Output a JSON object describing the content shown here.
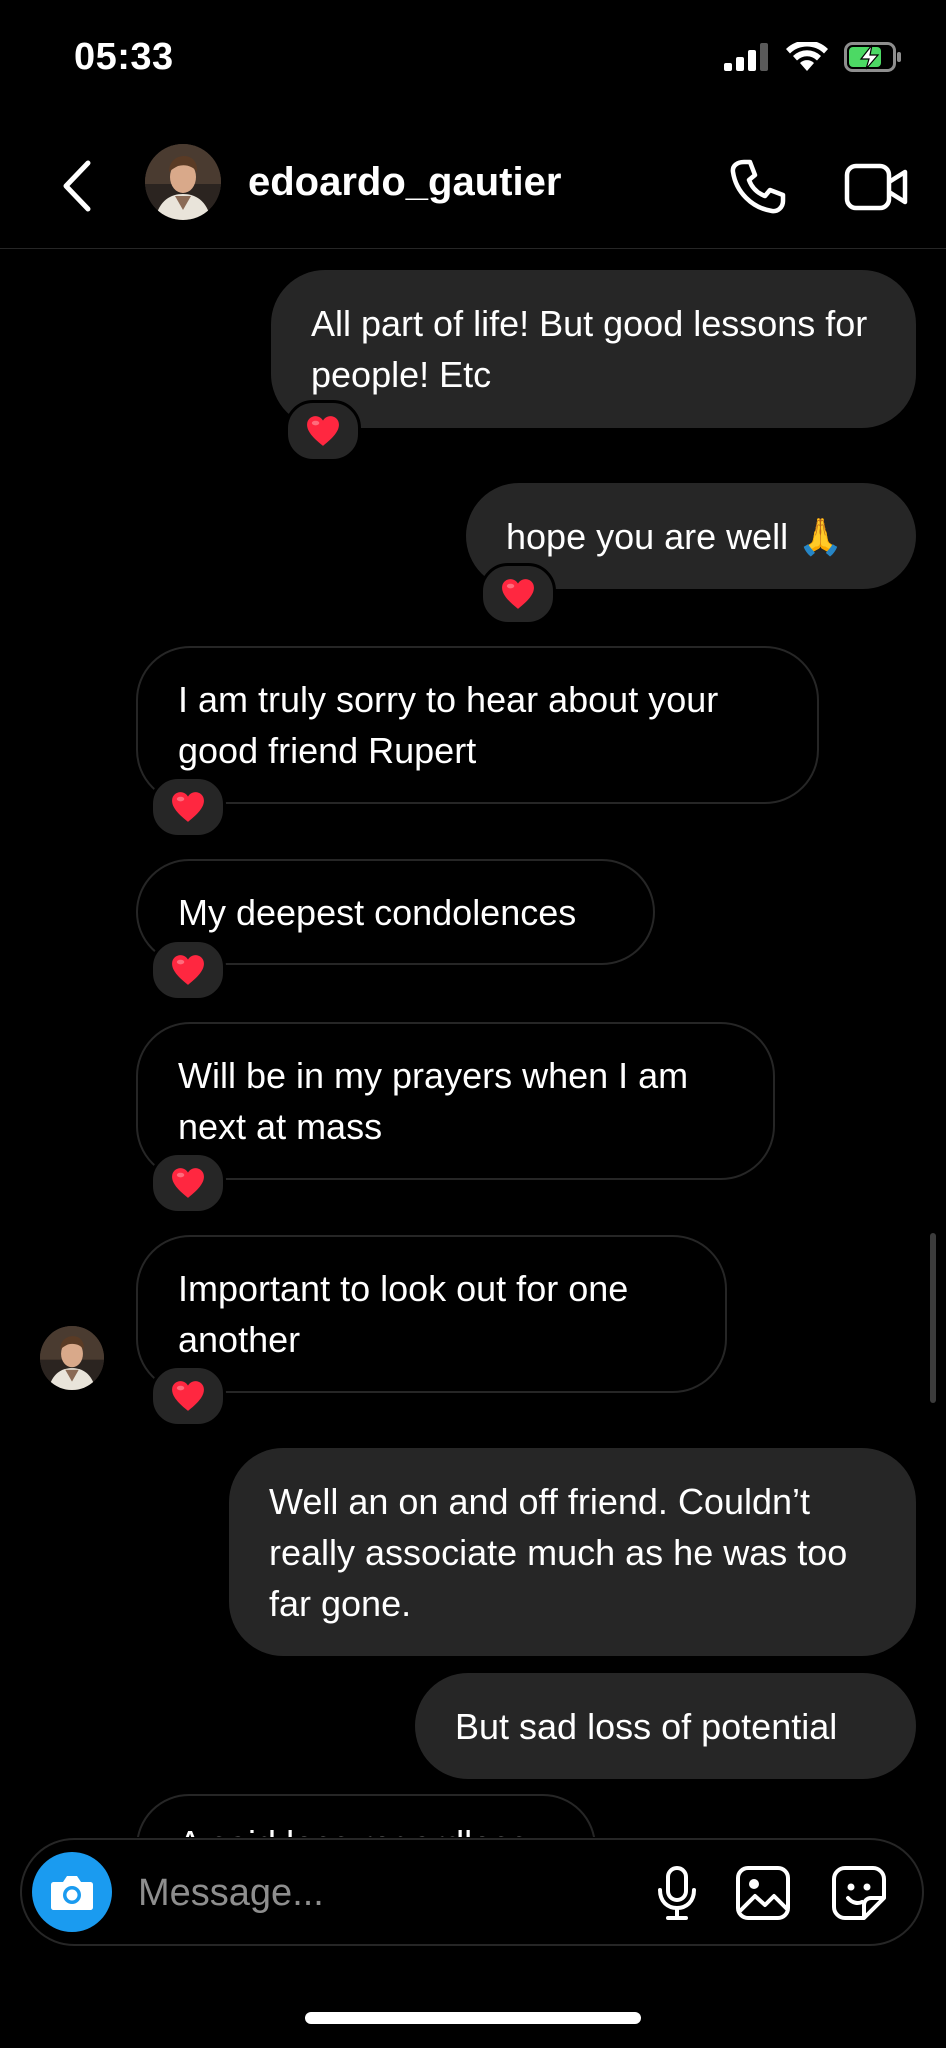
{
  "status_bar": {
    "time": "05:33"
  },
  "header": {
    "username": "edoardo_gautier"
  },
  "messages": [
    {
      "side": "out",
      "text": "All part of life! But good lessons for people! Etc",
      "reaction": "heart"
    },
    {
      "side": "out",
      "text": "hope you are well 🙏",
      "reaction": "heart"
    },
    {
      "side": "in",
      "text": "I am truly sorry to hear about your good friend Rupert",
      "reaction": "heart"
    },
    {
      "side": "in",
      "text": "My deepest condolences",
      "reaction": "heart"
    },
    {
      "side": "in",
      "text": "Will be in my prayers when I am next at mass",
      "reaction": "heart"
    },
    {
      "side": "in",
      "text": "Important to look out for one another",
      "reaction": "heart"
    },
    {
      "side": "out",
      "text": "Well an on and off friend. Couldn’t really associate much as he was too far gone."
    },
    {
      "side": "out",
      "text": "But sad loss of potential"
    },
    {
      "side": "in",
      "text": "A said loss regardless"
    }
  ],
  "composer": {
    "placeholder": "Message..."
  },
  "colors": {
    "bubble_out": "#262626",
    "accent": "#1a9bf0",
    "battery": "#4cd964"
  }
}
